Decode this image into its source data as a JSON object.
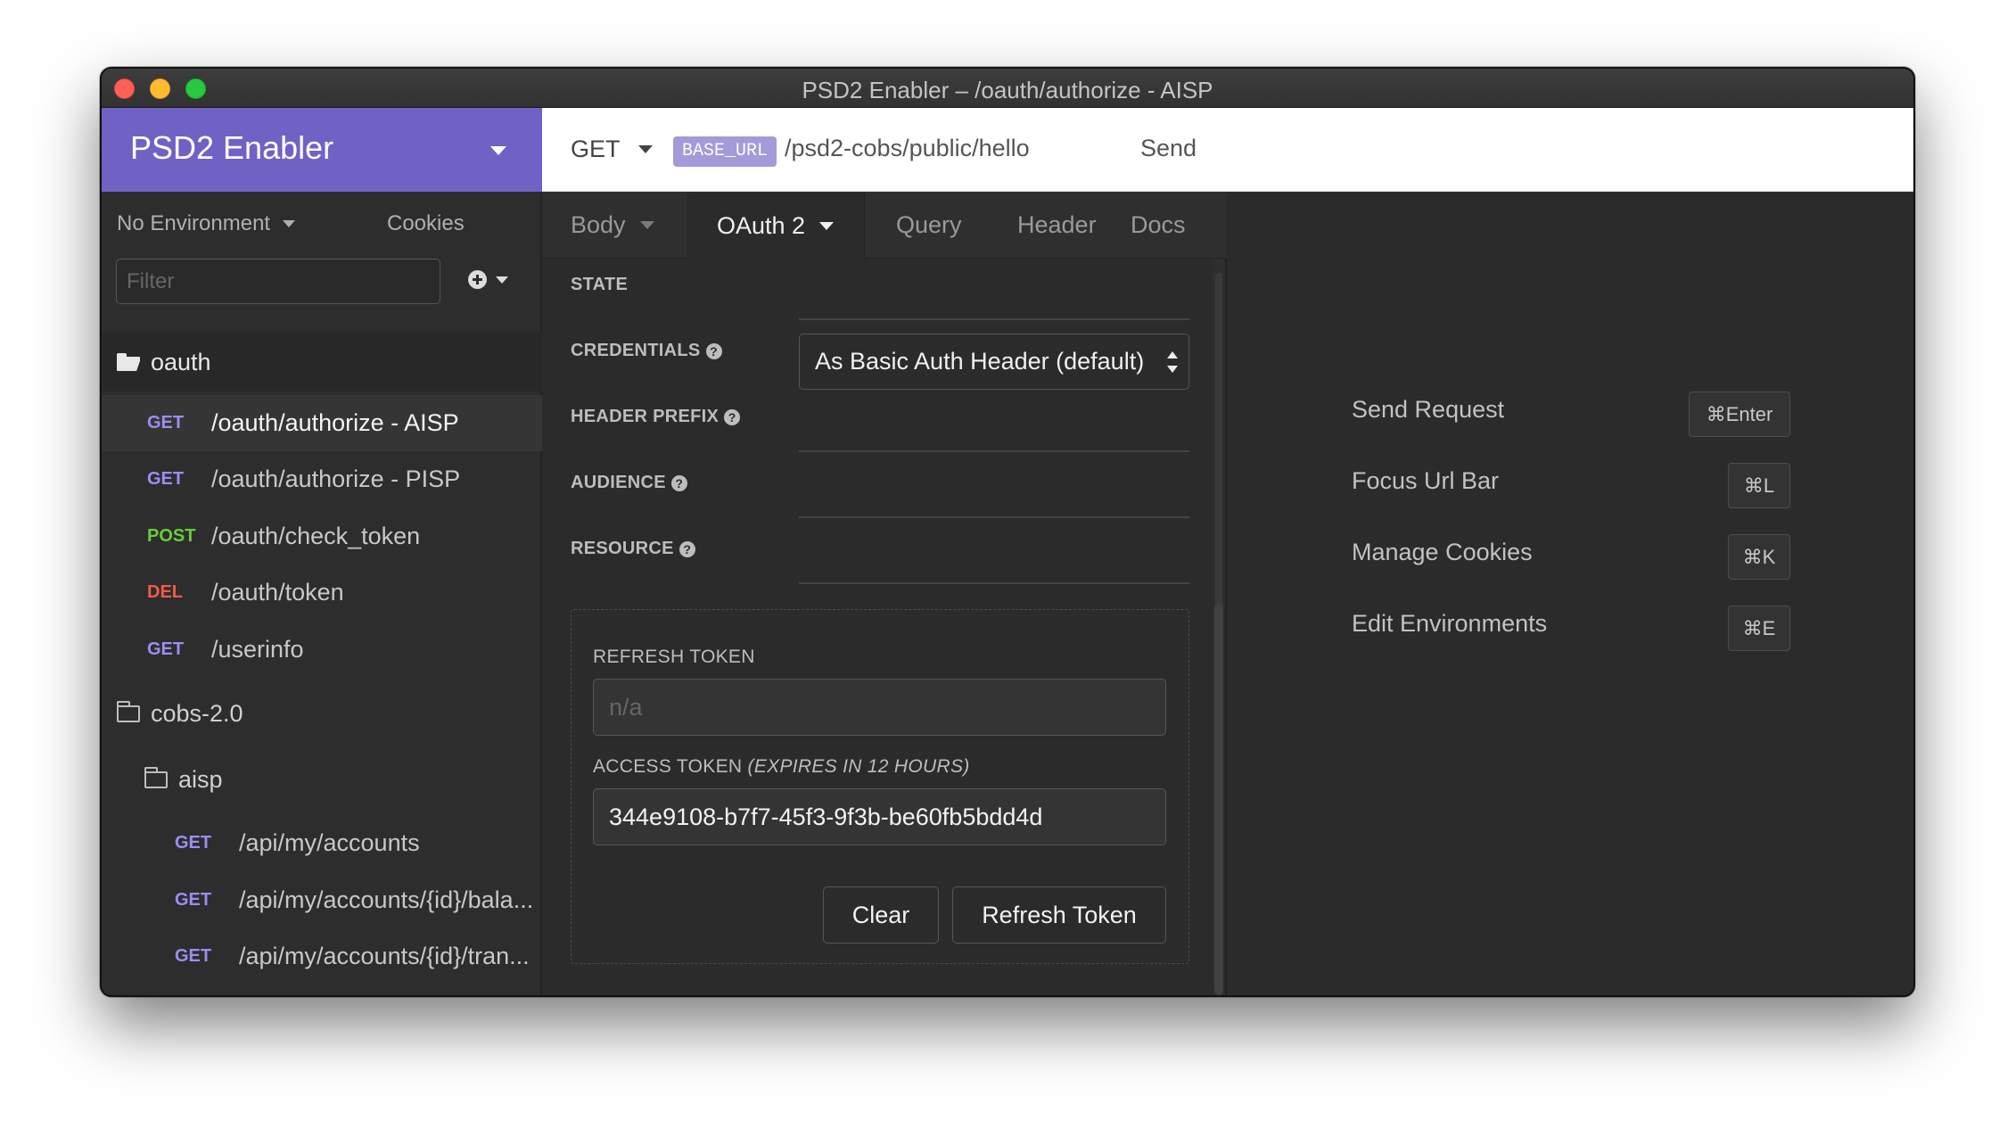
{
  "window": {
    "title": "PSD2 Enabler – /oauth/authorize - AISP"
  },
  "sidebar": {
    "workspace": "PSD2 Enabler",
    "environment": "No Environment",
    "cookies": "Cookies",
    "filter_placeholder": "Filter",
    "tree": [
      {
        "type": "folder",
        "label": "oauth",
        "open": true
      },
      {
        "method": "GET",
        "label": "/oauth/authorize - AISP",
        "active": true
      },
      {
        "method": "GET",
        "label": "/oauth/authorize - PISP"
      },
      {
        "method": "POST",
        "label": "/oauth/check_token"
      },
      {
        "method": "DEL",
        "label": "/oauth/token"
      },
      {
        "method": "GET",
        "label": "/userinfo"
      },
      {
        "type": "folder",
        "label": "cobs-2.0",
        "open": false
      },
      {
        "type": "folder",
        "label": "aisp",
        "open": false
      },
      {
        "method": "GET",
        "label": "/api/my/accounts"
      },
      {
        "method": "GET",
        "label": "/api/my/accounts/{id}/bala..."
      },
      {
        "method": "GET",
        "label": "/api/my/accounts/{id}/tran..."
      }
    ]
  },
  "request": {
    "method": "GET",
    "env_tag": "BASE_URL",
    "path": "/psd2-cobs/public/hello",
    "send": "Send",
    "tabs": [
      "Body",
      "OAuth 2",
      "Query",
      "Header",
      "Docs"
    ],
    "active_tab": "OAuth 2",
    "fields": {
      "state": "STATE",
      "credentials": "CREDENTIALS",
      "credentials_value": "As Basic Auth Header (default)",
      "header_prefix": "HEADER PREFIX",
      "audience": "AUDIENCE",
      "resource": "RESOURCE"
    },
    "token": {
      "refresh_label": "REFRESH TOKEN",
      "refresh_placeholder": "n/a",
      "access_label": "ACCESS TOKEN",
      "access_expiry": "(EXPIRES IN 12 HOURS)",
      "access_value": "344e9108-b7f7-45f3-9f3b-be60fb5bdd4d",
      "clear": "Clear",
      "refresh_button": "Refresh Token"
    }
  },
  "response": {
    "shortcuts": [
      {
        "label": "Send Request",
        "keys": "⌘Enter"
      },
      {
        "label": "Focus Url Bar",
        "keys": "⌘L"
      },
      {
        "label": "Manage Cookies",
        "keys": "⌘K"
      },
      {
        "label": "Edit Environments",
        "keys": "⌘E"
      }
    ]
  },
  "colors": {
    "workspace_header": "#7062c4",
    "method_get": "#9a8ff0",
    "method_post": "#69cd3a",
    "method_del": "#ee5d48",
    "env_tag": "#a39ad9"
  }
}
